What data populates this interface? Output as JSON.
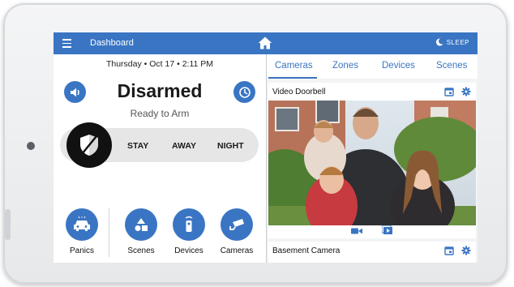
{
  "topbar": {
    "title": "Dashboard",
    "sleep_label": "SLEEP"
  },
  "status": {
    "datetime": "Thursday • Oct 17 • 2:11 PM",
    "arm_state": "Disarmed",
    "sub_state": "Ready to Arm",
    "arm_options": [
      "STAY",
      "AWAY",
      "NIGHT"
    ]
  },
  "tiles": [
    {
      "label": "Panics",
      "icon": "car-alarm-icon"
    },
    {
      "label": "Scenes",
      "icon": "shapes-icon"
    },
    {
      "label": "Devices",
      "icon": "remote-icon"
    },
    {
      "label": "Cameras",
      "icon": "security-camera-icon"
    }
  ],
  "tabs": [
    "Cameras",
    "Zones",
    "Devices",
    "Scenes"
  ],
  "active_tab": "Cameras",
  "cameras": [
    {
      "name": "Video Doorbell"
    },
    {
      "name": "Basement Camera"
    }
  ],
  "colors": {
    "accent": "#3a75c4",
    "knob": "#111111",
    "armbar": "#e6e6e6"
  }
}
